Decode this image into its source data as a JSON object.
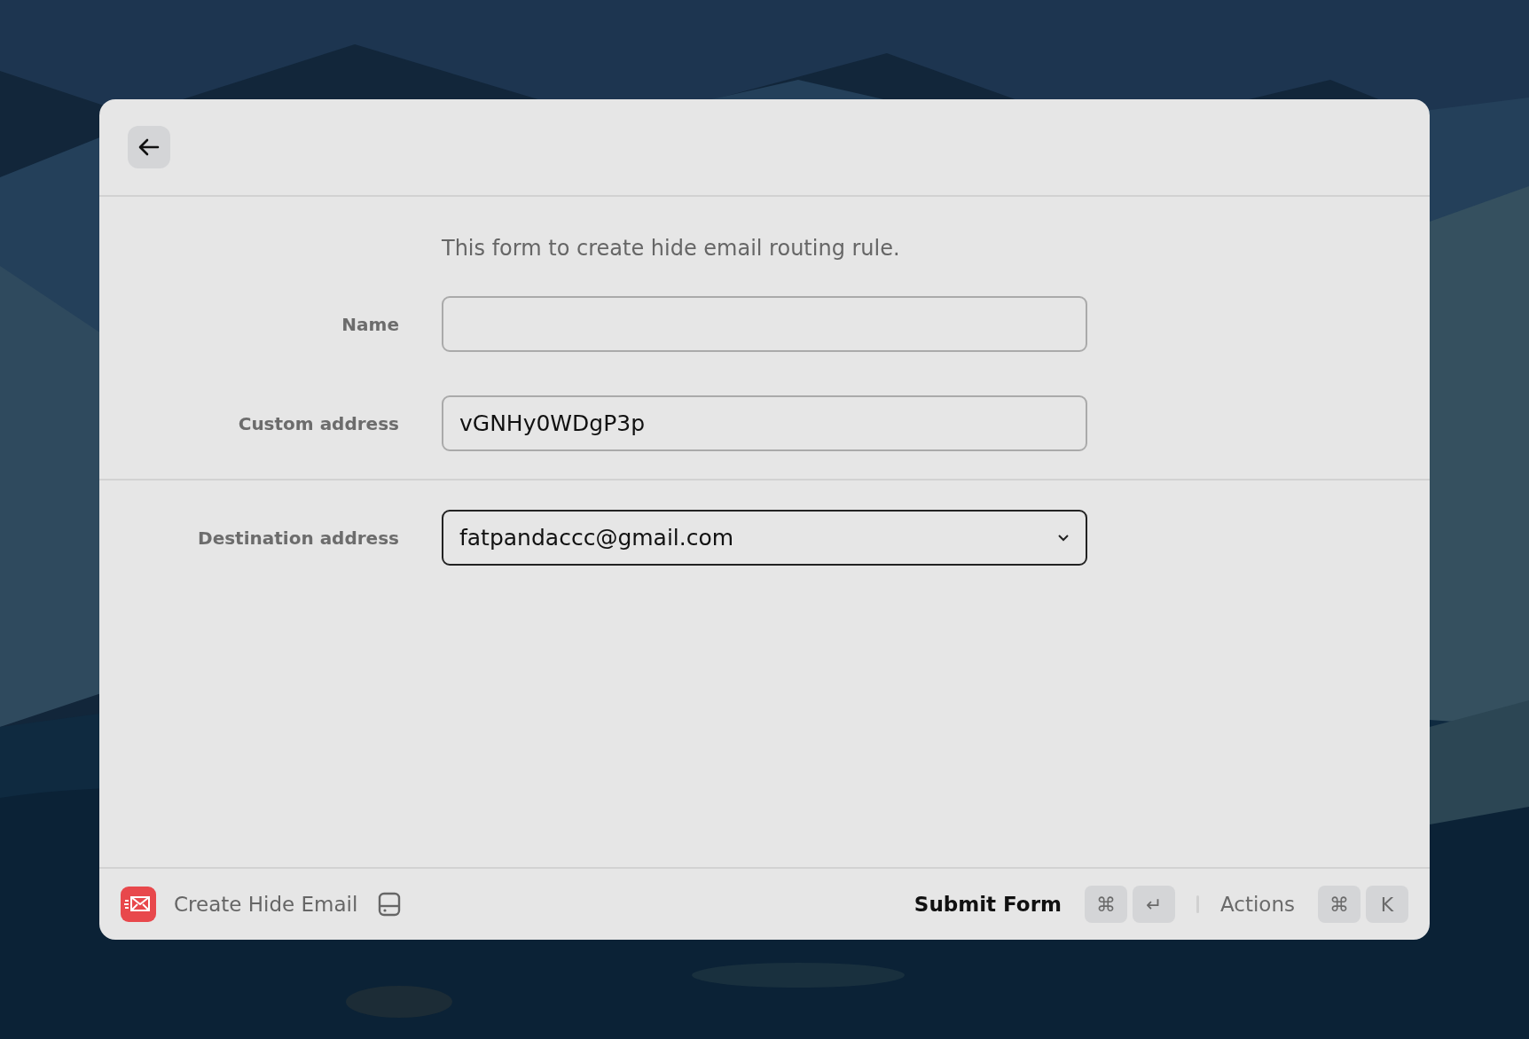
{
  "description": "This form to create hide email routing rule.",
  "fields": [
    {
      "label": "Name",
      "kind": "text",
      "focused": false,
      "section_break": false
    },
    {
      "label": "Custom address",
      "kind": "text",
      "value": "vGNHy0WDgP3p",
      "focused": false,
      "section_break": false
    },
    {
      "label": "Destination address",
      "kind": "select",
      "value": "fatpandaccc@gmail.com",
      "focused": true,
      "section_break": true
    }
  ],
  "footer": {
    "command": "Create Hide Email",
    "actions": [
      {
        "label": "Submit Form",
        "primary": true,
        "keys": [
          "⌘",
          "↵"
        ]
      },
      {
        "label": "Actions",
        "primary": false,
        "keys": [
          "⌘",
          "K"
        ]
      }
    ]
  }
}
